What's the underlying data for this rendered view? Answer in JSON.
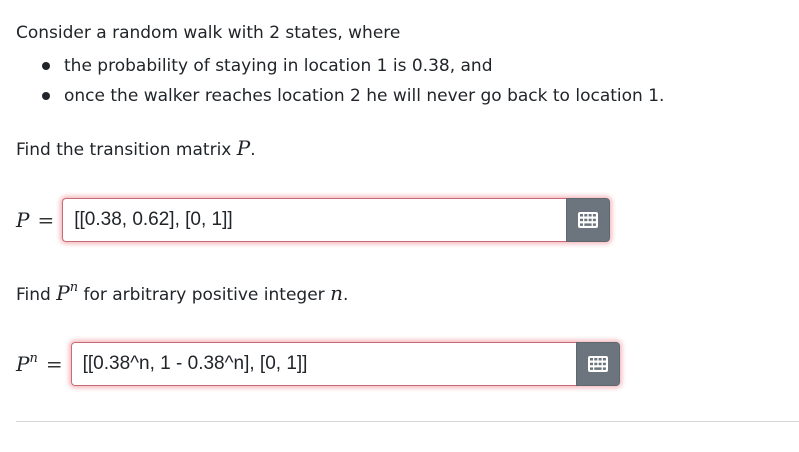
{
  "intro": "Consider a random walk with 2 states, where",
  "bullets": [
    "the probability of staying in location 1 is 0.38, and",
    "once the walker reaches location 2 he will never go back to location 1."
  ],
  "question1": {
    "text": "Find the transition matrix ",
    "math": "P",
    "suffix": "."
  },
  "answer1": {
    "label_var": "P",
    "label_eq": "=",
    "value": "[[0.38, 0.62], [0, 1]]"
  },
  "question2": {
    "text_before": "Find ",
    "math": "P",
    "math_sup": "n",
    "text_after": " for arbitrary positive integer ",
    "math2": "n",
    "suffix": "."
  },
  "answer2": {
    "label_var": "P",
    "label_sup": "n",
    "label_eq": "=",
    "value": "[[0.38^n, 1 - 0.38^n], [0, 1]]"
  },
  "icons": {
    "input_button_icon": "keyboard-icon"
  },
  "colors": {
    "input_border_invalid": "#c96b74",
    "button_bg": "#6c757d"
  }
}
